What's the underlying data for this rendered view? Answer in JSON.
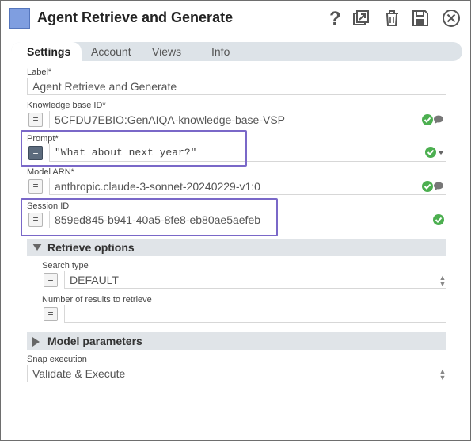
{
  "window": {
    "title": "Agent Retrieve and Generate",
    "icon_color": "#7f9ee0",
    "buttons": [
      "help-icon",
      "export-icon",
      "trash-icon",
      "save-icon",
      "close-icon"
    ]
  },
  "tabs": [
    {
      "label": "Settings",
      "active": true
    },
    {
      "label": "Account",
      "active": false
    },
    {
      "label": "Views",
      "active": false
    },
    {
      "label": "Info",
      "active": false
    }
  ],
  "fields": {
    "label": {
      "label": "Label*",
      "value": "Agent Retrieve and Generate"
    },
    "kb": {
      "label": "Knowledge base ID*",
      "value": "5CFDU7EBIO:GenAIQA-knowledge-base-VSP",
      "eq": "="
    },
    "prompt": {
      "label": "Prompt*",
      "value": "\"What about next year?\"",
      "eq": "="
    },
    "model": {
      "label": "Model ARN*",
      "value": "anthropic.claude-3-sonnet-20240229-v1:0",
      "eq": "="
    },
    "session": {
      "label": "Session ID",
      "value": "859ed845-b941-40a5-8fe8-eb80ae5aefeb",
      "eq": "="
    }
  },
  "retrieve": {
    "title": "Retrieve options",
    "expanded": true,
    "search_type": {
      "label": "Search type",
      "value": "DEFAULT",
      "eq": "="
    },
    "num_results": {
      "label": "Number of results to retrieve",
      "value": "",
      "eq": "="
    }
  },
  "model_params": {
    "title": "Model parameters",
    "expanded": false
  },
  "snap": {
    "label": "Snap execution",
    "value": "Validate & Execute"
  },
  "colors": {
    "accent": "#7a68c8",
    "ok": "#4caf50",
    "tabbar": "#dde3e8"
  }
}
